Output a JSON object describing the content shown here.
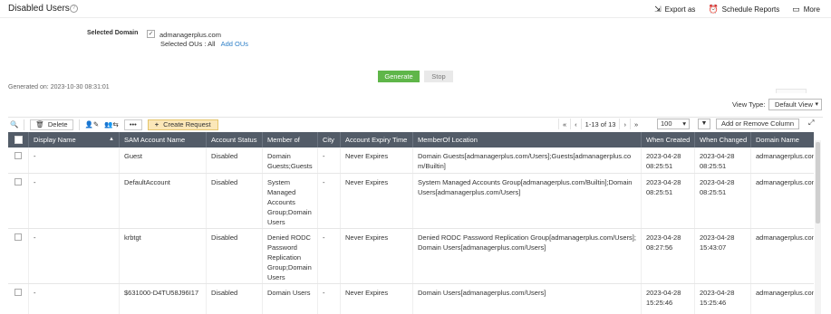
{
  "header": {
    "title": "Disabled Users",
    "help_glyph": "?",
    "actions": [
      {
        "icon": "export-icon",
        "glyph": "⇲",
        "label": "Export as"
      },
      {
        "icon": "schedule-icon",
        "glyph": "⏰",
        "label": "Schedule Reports"
      },
      {
        "icon": "more-icon",
        "glyph": "▭",
        "label": "More"
      }
    ]
  },
  "filters": {
    "domain_label": "Selected Domain",
    "domain_check": "✓",
    "domain_value": "admanagerplus.com",
    "ous_label": "Selected OUs :",
    "ous_value": "All",
    "add_ous": "Add OUs"
  },
  "buttons": {
    "generate": "Generate",
    "stop": "Stop"
  },
  "generated_on": "Generated on: 2023-10-30 08:31:01",
  "view": {
    "label": "View Type:",
    "value": "Default View"
  },
  "toolbar": {
    "search_glyph": "🔍",
    "delete": "Delete",
    "delete_glyph": "🗑",
    "enable_glyph": "👤✎",
    "move_glyph": "👥⇆",
    "more_glyph": "•••",
    "create_glyph": "+",
    "create": "Create Request"
  },
  "pager": {
    "first": "«",
    "prev": "‹",
    "range": "1-13 of 13",
    "next": "›",
    "last": "»",
    "per_page": "100",
    "filter_glyph": "▼",
    "add_remove": "Add or Remove Column",
    "expand_glyph": "⤢"
  },
  "columns": [
    "Display Name",
    "SAM Account Name",
    "Account Status",
    "Member of",
    "City",
    "Account Expiry Time",
    "MemberOf Location",
    "When Created",
    "When Changed",
    "Domain Name"
  ],
  "sort_glyph": "▲",
  "rows": [
    {
      "display": "-",
      "sam": "Guest",
      "status": "Disabled",
      "member": "Domain Guests;Guests",
      "city": "-",
      "expiry": "Never Expires",
      "location": "Domain Guests[admanagerplus.com/Users];Guests[admanagerplus.com/Builtin]",
      "created": "2023-04-28 08:25:51",
      "changed": "2023-04-28 08:25:51",
      "domain": "admanagerplus.com"
    },
    {
      "display": "-",
      "sam": "DefaultAccount",
      "status": "Disabled",
      "member": "System Managed Accounts Group;Domain Users",
      "city": "-",
      "expiry": "Never Expires",
      "location": "System Managed Accounts Group[admanagerplus.com/Builtin];Domain Users[admanagerplus.com/Users]",
      "created": "2023-04-28 08:25:51",
      "changed": "2023-04-28 08:25:51",
      "domain": "admanagerplus.com"
    },
    {
      "display": "-",
      "sam": "krbtgt",
      "status": "Disabled",
      "member": "Denied RODC Password Replication Group;Domain Users",
      "city": "-",
      "expiry": "Never Expires",
      "location": "Denied RODC Password Replication Group[admanagerplus.com/Users];Domain Users[admanagerplus.com/Users]",
      "created": "2023-04-28 08:27:56",
      "changed": "2023-04-28 15:43:07",
      "domain": "admanagerplus.com"
    },
    {
      "display": "-",
      "sam": "$631000-D4TU58J96I17",
      "status": "Disabled",
      "member": "Domain Users",
      "city": "-",
      "expiry": "Never Expires",
      "location": "Domain Users[admanagerplus.com/Users]",
      "created": "2023-04-28 15:25:46",
      "changed": "2023-04-28 15:25:46",
      "domain": "admanagerplus.com"
    }
  ]
}
